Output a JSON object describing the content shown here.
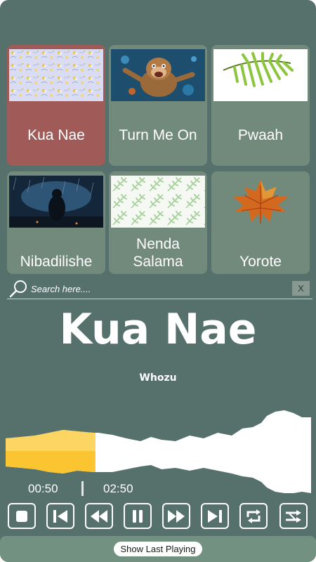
{
  "songs": [
    {
      "title": "Kua Nae",
      "lines": [
        "Kua Nae"
      ],
      "image": "floral-pattern",
      "active": true
    },
    {
      "title": "Turn Me On",
      "lines": [
        "Turn Me On"
      ],
      "image": "monkey-underwater",
      "active": false
    },
    {
      "title": "Pwaah",
      "lines": [
        "Pwaah"
      ],
      "image": "palm-leaf",
      "active": false
    },
    {
      "title": "Nibadilishe",
      "lines": [
        "Nibadilishe"
      ],
      "image": "figure-in-rain",
      "active": false
    },
    {
      "title": "Nenda Salama",
      "lines": [
        "Nenda",
        "Salama"
      ],
      "image": "fern-pattern",
      "active": false
    },
    {
      "title": "Yorote",
      "lines": [
        "Yorote"
      ],
      "image": "autumn-maple-leaf",
      "active": false
    }
  ],
  "search": {
    "placeholder": "Search here....",
    "value": "",
    "clear_label": "X"
  },
  "now_playing": {
    "title": "Kua Nae",
    "artist": "Whozu",
    "current_time": "00:50",
    "total_time": "02:50",
    "progress": 0.294
  },
  "controls": [
    "stop",
    "previous",
    "rewind",
    "pause",
    "fast-forward",
    "next",
    "repeat",
    "shuffle"
  ],
  "footer": {
    "show_last_label": "Show Last Playing"
  },
  "colors": {
    "background": "#56716b",
    "card": "#728a7c",
    "active_card": "#a05b59",
    "wave_played": "#fbc532",
    "wave_unplayed": "#ffffff",
    "footer": "#739181"
  }
}
